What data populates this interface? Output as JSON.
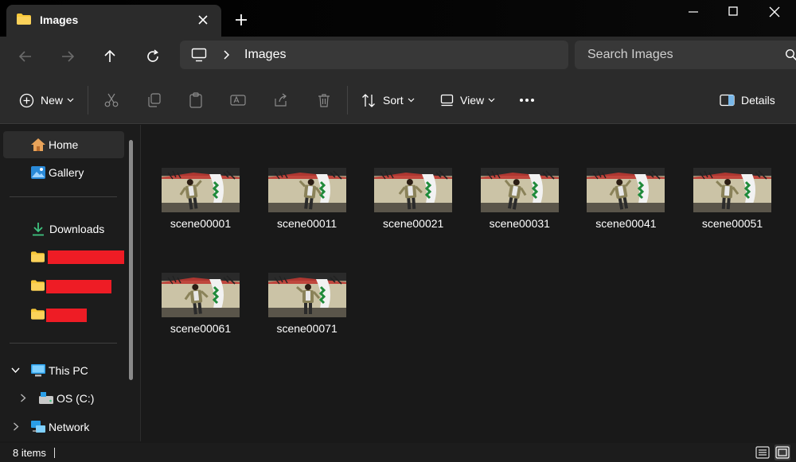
{
  "window": {
    "tab_title": "Images",
    "controls": [
      "minimize",
      "maximize",
      "close"
    ]
  },
  "navigation": {
    "back_icon": "arrow-left-icon",
    "forward_icon": "arrow-right-icon",
    "up_icon": "arrow-up-icon",
    "refresh_icon": "refresh-icon",
    "breadcrumb_root_icon": "this-pc-icon",
    "breadcrumb": [
      "Images"
    ],
    "search_placeholder": "Search Images"
  },
  "toolbar": {
    "new_label": "New",
    "sort_label": "Sort",
    "view_label": "View",
    "more_label": "•••",
    "details_label": "Details",
    "disabled_actions": [
      "cut",
      "copy",
      "paste",
      "rename",
      "share",
      "delete"
    ]
  },
  "sidebar": {
    "home": "Home",
    "gallery": "Gallery",
    "downloads": "Downloads",
    "redacted_folders": 3,
    "this_pc": "This PC",
    "os_drive": "OS (C:)",
    "network": "Network"
  },
  "files": [
    {
      "name": "scene00001",
      "pose": "a"
    },
    {
      "name": "scene00011",
      "pose": "b"
    },
    {
      "name": "scene00021",
      "pose": "c"
    },
    {
      "name": "scene00031",
      "pose": "d"
    },
    {
      "name": "scene00041",
      "pose": "e"
    },
    {
      "name": "scene00051",
      "pose": "f"
    },
    {
      "name": "scene00061",
      "pose": "g"
    },
    {
      "name": "scene00071",
      "pose": "h"
    }
  ],
  "status": {
    "item_count": "8 items"
  },
  "colors": {
    "accent_folder": "#f8c83a",
    "redaction": "#ee1c25",
    "background": "#191919",
    "chrome": "#2b2b2b"
  }
}
